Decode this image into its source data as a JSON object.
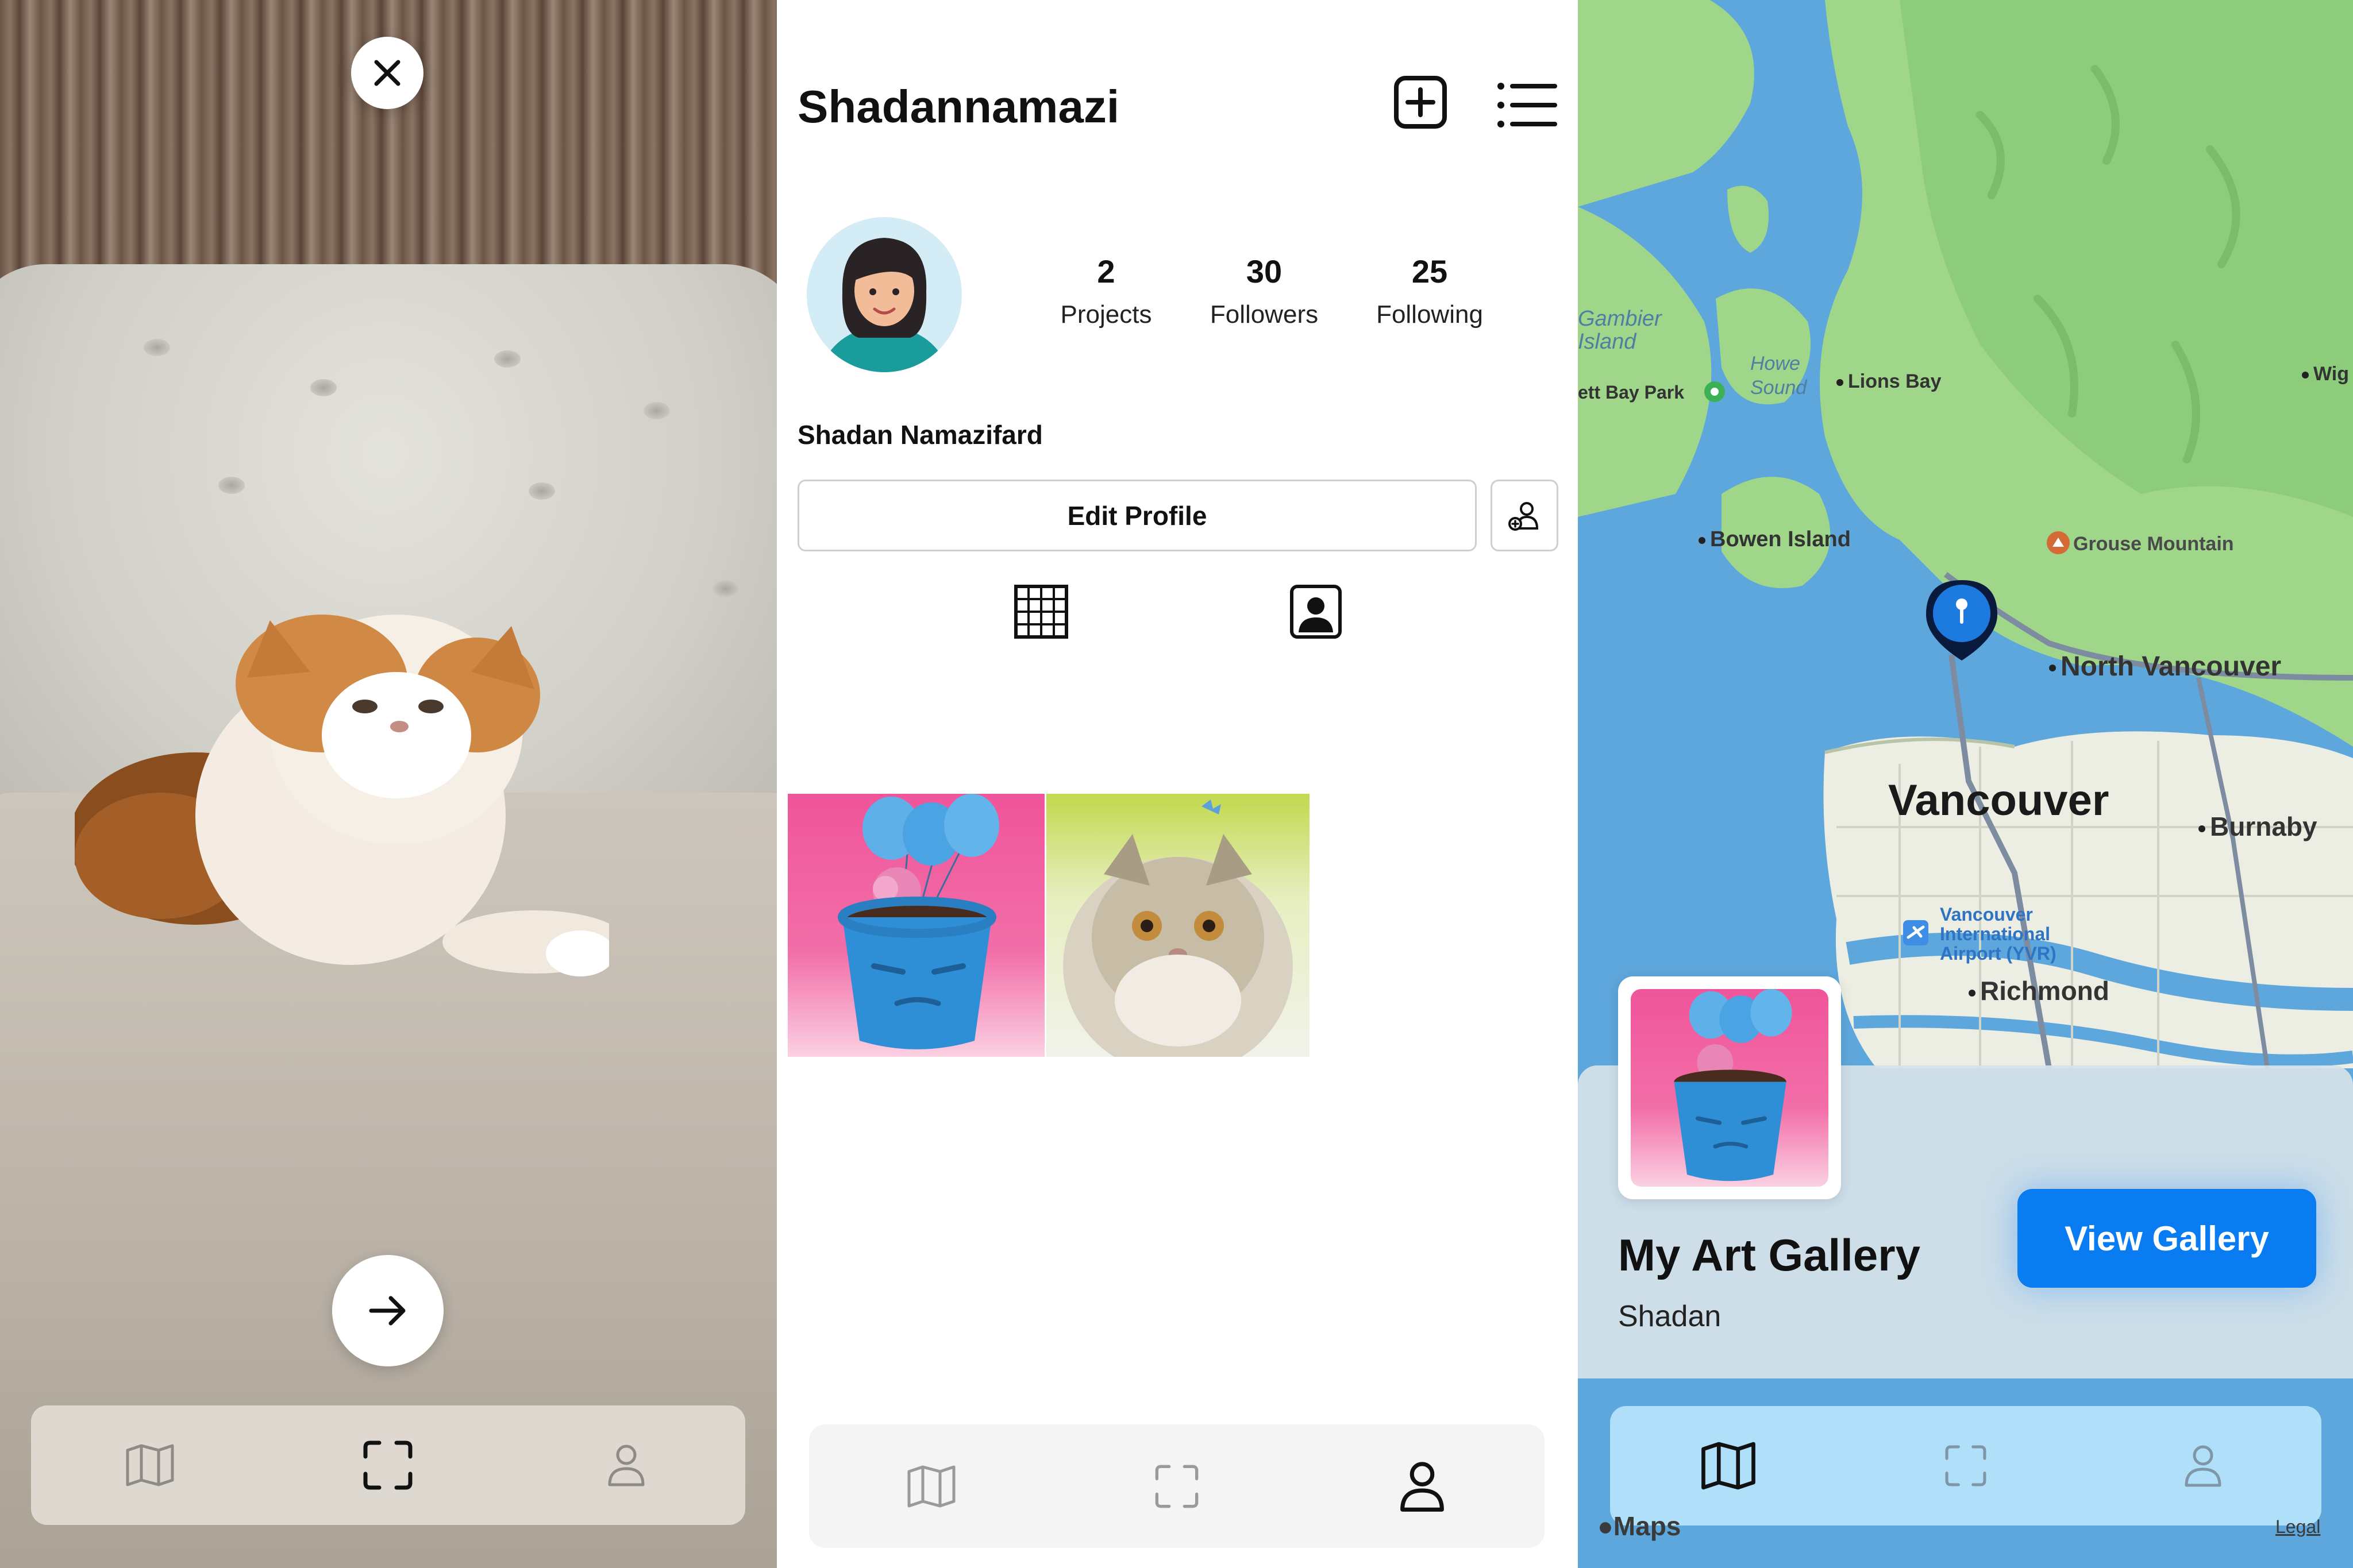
{
  "camera": {
    "close_icon": "close-icon",
    "next_icon": "arrow-right-icon",
    "tabs": [
      {
        "name": "map-icon"
      },
      {
        "name": "scan-icon"
      },
      {
        "name": "profile-icon"
      }
    ]
  },
  "profile": {
    "username": "Shadannamazi",
    "full_name": "Shadan Namazifard",
    "stats": [
      {
        "value": "2",
        "label": "Projects"
      },
      {
        "value": "30",
        "label": "Followers"
      },
      {
        "value": "25",
        "label": "Following"
      }
    ],
    "edit_profile_label": "Edit Profile",
    "tabs": [
      {
        "name": "grid-icon"
      },
      {
        "name": "tagged-icon"
      }
    ]
  },
  "map": {
    "labels": {
      "gambier": "Gambier\nIsland",
      "howe_sound": "Howe\nSound",
      "lions_bay": "Lions Bay",
      "park": "ett Bay Park",
      "wig": "Wig",
      "bowen": "Bowen Island",
      "grouse": "Grouse Mountain",
      "north_van": "North Vancouver",
      "vancouver": "Vancouver",
      "burnaby": "Burnaby",
      "airport": "Vancouver\nInternational\nAirport (YVR)",
      "richmond": "Richmond",
      "maps": "Maps",
      "legal": "Legal"
    },
    "card": {
      "title": "My Art Gallery",
      "subtitle": "Shadan",
      "button_label": "View Gallery"
    }
  },
  "colors": {
    "accent": "#0a7cf2",
    "map_water": "#5ea7dc",
    "map_land": "#9fd68a",
    "profile_thumb_bg": "#f0559a"
  }
}
